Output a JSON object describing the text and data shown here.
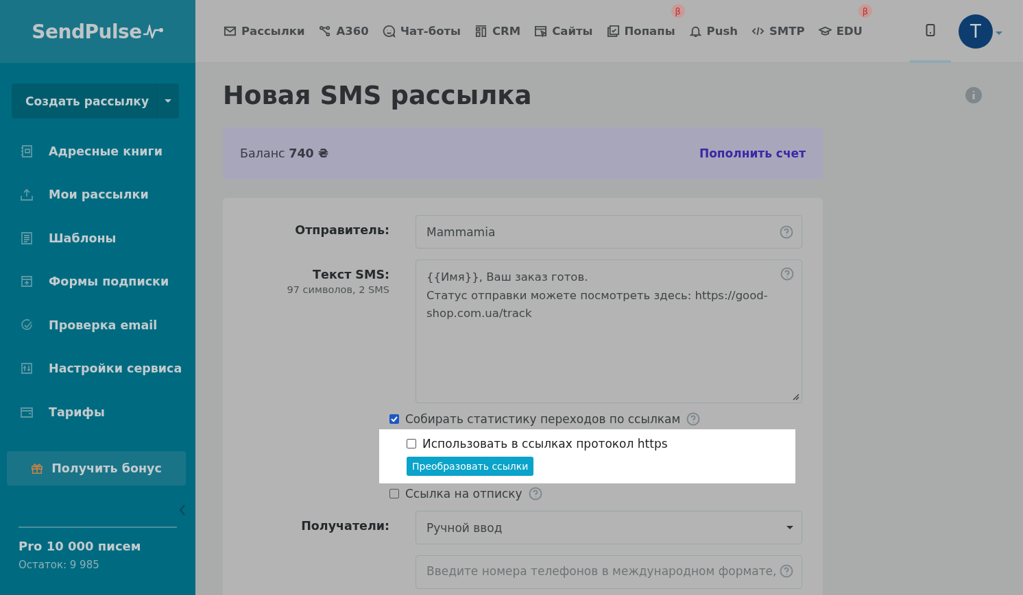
{
  "sidebar": {
    "logo": "SendPulse",
    "create_button": "Создать рассылку",
    "items": [
      {
        "label": "Адресные книги",
        "kind": "book"
      },
      {
        "label": "Мои рассылки",
        "kind": "upload"
      },
      {
        "label": "Шаблоны",
        "kind": "template"
      },
      {
        "label": "Формы подписки",
        "kind": "form"
      },
      {
        "label": "Проверка email",
        "kind": "check"
      },
      {
        "label": "Настройки сервиса",
        "kind": "sliders"
      },
      {
        "label": "Тарифы",
        "kind": "wallet"
      }
    ],
    "bonus_button": "Получить бонус",
    "plan": {
      "name": "Pro 10 000 писем",
      "remaining": "Остаток: 9 985"
    }
  },
  "nav": {
    "items": [
      {
        "label": "Рассылки",
        "kind": "mail"
      },
      {
        "label": "A360",
        "kind": "nodes"
      },
      {
        "label": "Чат-боты",
        "kind": "chat"
      },
      {
        "label": "CRM",
        "kind": "crm"
      },
      {
        "label": "Сайты",
        "kind": "site"
      },
      {
        "label": "Попапы",
        "kind": "popup",
        "badge": "β"
      },
      {
        "label": "Push",
        "kind": "bell"
      },
      {
        "label": "SMTP",
        "kind": "code"
      },
      {
        "label": "EDU",
        "kind": "cap",
        "badge": "β"
      }
    ],
    "device_preview_selected": true,
    "avatar": "T"
  },
  "title": "Новая SMS рассылка",
  "balance": {
    "text": "Баланс **740 ₴**",
    "topup_link": "Пополнить счет"
  },
  "form": {
    "sender": {
      "label": "Отправитель:",
      "value": "Mammamia"
    },
    "sms_text": {
      "label": "Текст SMS:",
      "counter": "97 символов, 2 SMS",
      "lines": [
        "{{Имя}}, Ваш заказ готов.",
        "Статус отправки можете посмотреть здесь: https://good-",
        "shop.com.ua/track"
      ]
    },
    "track_links": {
      "label": "Собирать статистику переходов по ссылкам",
      "checked": true
    },
    "https": {
      "label": "Использовать в ссылках протокол https",
      "checked": false
    },
    "convert_button": "Преобразовать ссылки",
    "unsubscribe": {
      "label": "Ссылка на отписку",
      "checked": false
    },
    "recipients": {
      "label": "Получатели:",
      "value": "Ручной ввод"
    },
    "phones": {
      "placeholder": "Введите номера телефонов в международном формате,"
    }
  }
}
